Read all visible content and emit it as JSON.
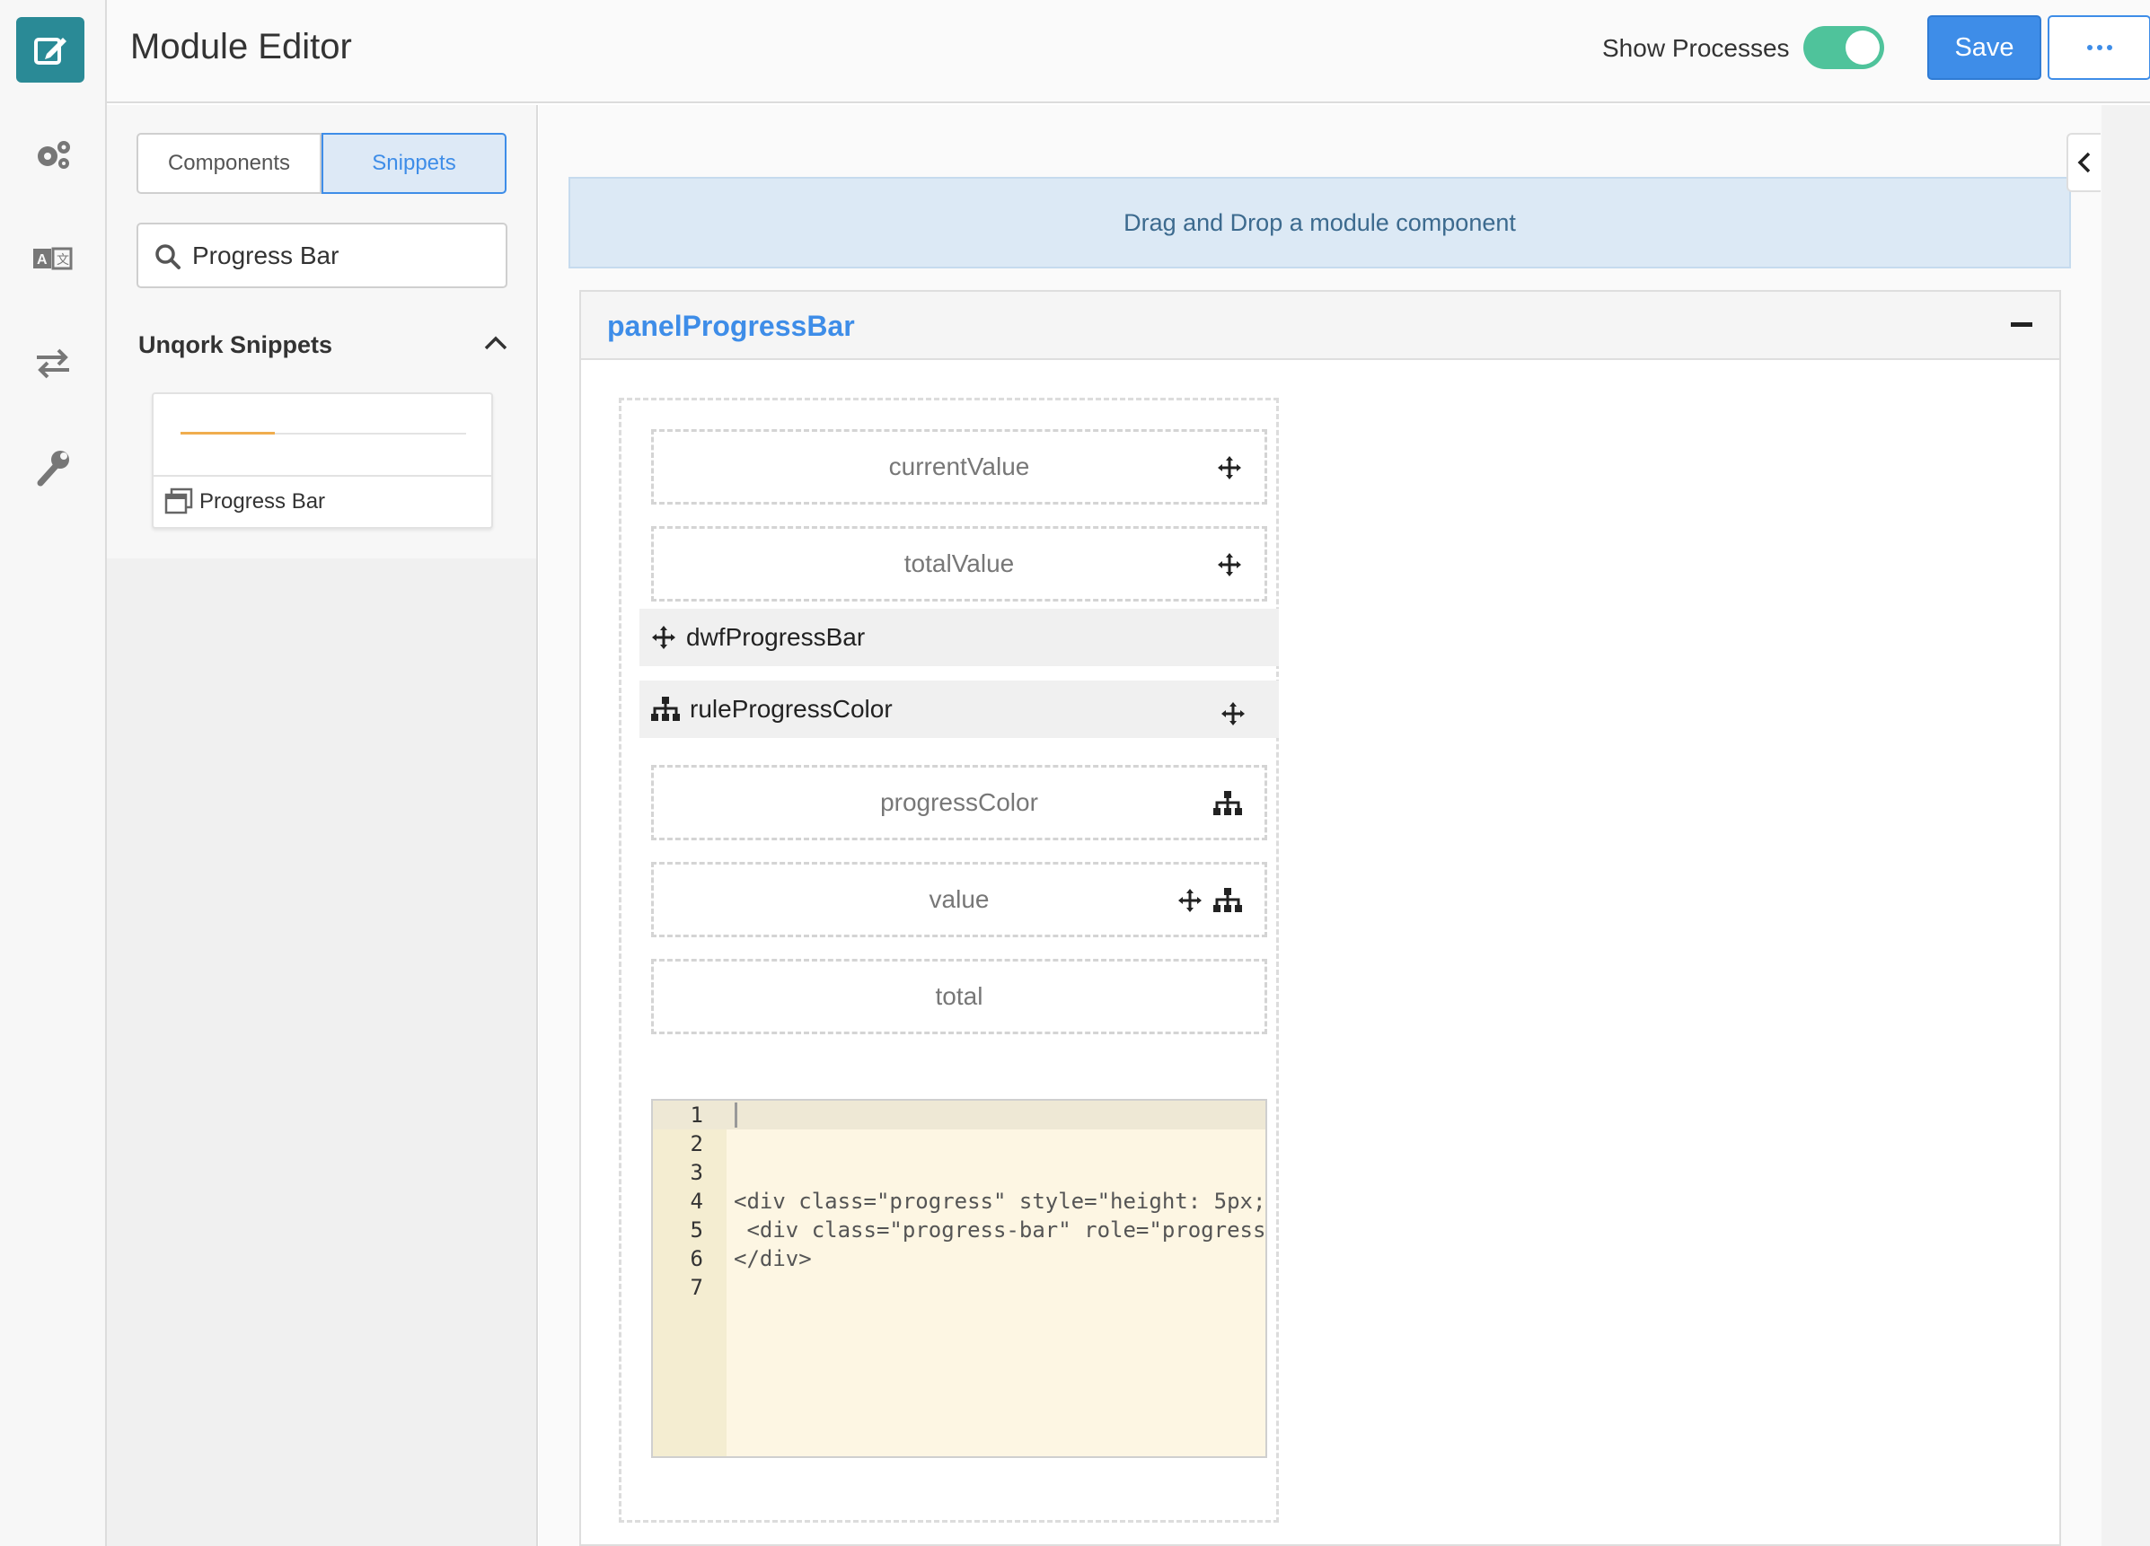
{
  "header": {
    "title": "Module Editor",
    "show_processes_label": "Show Processes",
    "show_processes_on": true,
    "save_label": "Save"
  },
  "rail": {
    "items": [
      "edit-icon",
      "gears-icon",
      "translate-icon",
      "transfer-icon",
      "wrench-icon"
    ],
    "active": "edit-icon"
  },
  "left_panel": {
    "tabs": [
      {
        "label": "Components",
        "active": false
      },
      {
        "label": "Snippets",
        "active": true
      }
    ],
    "search": {
      "value": "Progress Bar"
    },
    "section": {
      "title": "Unqork Snippets",
      "expanded": true
    },
    "snippets": [
      {
        "label": "Progress Bar",
        "preview_progress": 0.33
      }
    ]
  },
  "canvas": {
    "dropzone_text": "Drag and Drop a module component",
    "panel": {
      "title": "panelProgressBar",
      "fields": [
        {
          "key": "currentValue"
        },
        {
          "key": "totalValue"
        },
        {
          "key": "dwfProgressBar"
        },
        {
          "key": "ruleProgressColor"
        },
        {
          "key": "progressColor"
        },
        {
          "key": "value"
        },
        {
          "key": "total"
        }
      ],
      "code_lines": [
        {
          "n": "1",
          "text": ""
        },
        {
          "n": "2",
          "text": ""
        },
        {
          "n": "3",
          "text": ""
        },
        {
          "n": "4",
          "text": "<div class=\"progress\" style=\"height: 5px;"
        },
        {
          "n": "5",
          "text": " <div class=\"progress-bar\" role=\"progress"
        },
        {
          "n": "6",
          "text": "</div>"
        },
        {
          "n": "7",
          "text": ""
        }
      ]
    }
  },
  "colors": {
    "accent": "#3e8de8",
    "rail_active": "#2a8a96",
    "toggle_on": "#4fc39b",
    "progress_fill": "#f0ad4e"
  }
}
